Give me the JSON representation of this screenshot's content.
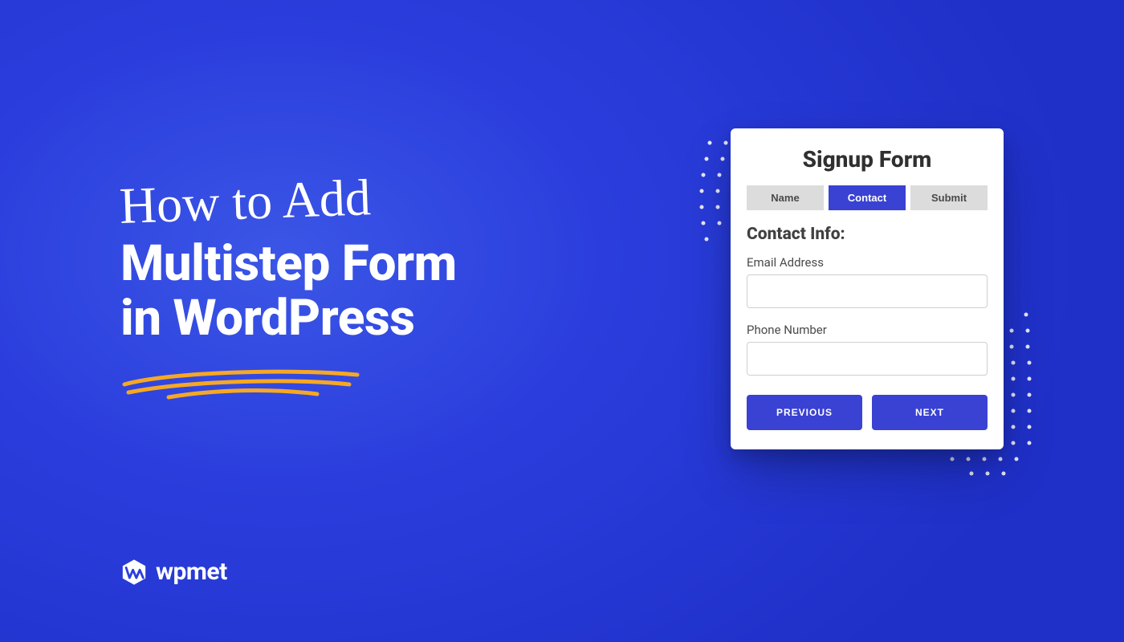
{
  "colors": {
    "bg_from": "#3b56e6",
    "bg_to": "#1f30c8",
    "accent": "#3942d2",
    "scribble": "#f7a823"
  },
  "headline": {
    "script": "How to Add",
    "line1": "Multistep Form",
    "line2": "in WordPress"
  },
  "brand": {
    "name": "wpmet"
  },
  "form": {
    "title": "Signup Form",
    "tabs": [
      "Name",
      "Contact",
      "Submit"
    ],
    "active_tab_index": 1,
    "section_title": "Contact Info:",
    "fields": [
      {
        "label": "Email Address",
        "value": ""
      },
      {
        "label": "Phone Number",
        "value": ""
      }
    ],
    "buttons": {
      "previous": "PREVIOUS",
      "next": "NEXT"
    }
  }
}
